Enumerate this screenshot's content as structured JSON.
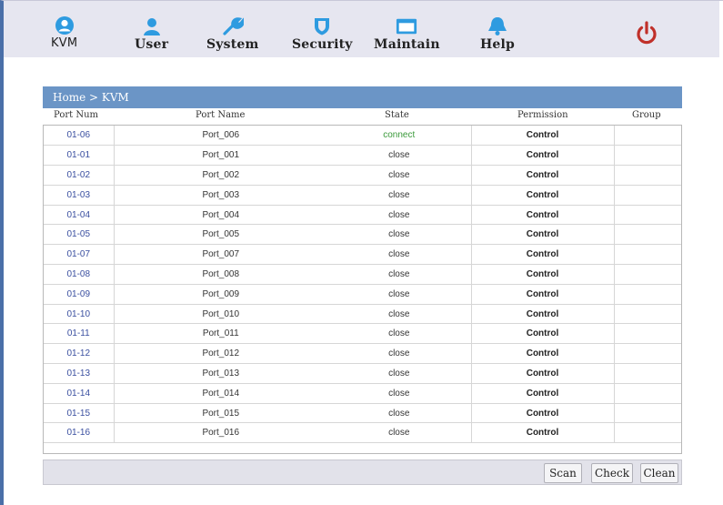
{
  "nav": {
    "items": [
      {
        "label": "KVM",
        "icon": "user-circle-icon"
      },
      {
        "label": "User",
        "icon": "user-icon"
      },
      {
        "label": "System",
        "icon": "wrench-icon"
      },
      {
        "label": "Security",
        "icon": "shield-icon"
      },
      {
        "label": "Maintain",
        "icon": "monitor-icon"
      },
      {
        "label": "Help",
        "icon": "bell-icon"
      }
    ],
    "power_icon": "power-icon",
    "accent": "#2e9be0",
    "power_color": "#c0302a"
  },
  "breadcrumb": "Home > KVM",
  "columns": {
    "num": "Port Num",
    "name": "Port Name",
    "state": "State",
    "perm": "Permission",
    "group": "Group"
  },
  "rows": [
    {
      "num": "01-06",
      "name": "Port_006",
      "state": "connect",
      "perm": "Control",
      "group": ""
    },
    {
      "num": "01-01",
      "name": "Port_001",
      "state": "close",
      "perm": "Control",
      "group": ""
    },
    {
      "num": "01-02",
      "name": "Port_002",
      "state": "close",
      "perm": "Control",
      "group": ""
    },
    {
      "num": "01-03",
      "name": "Port_003",
      "state": "close",
      "perm": "Control",
      "group": ""
    },
    {
      "num": "01-04",
      "name": "Port_004",
      "state": "close",
      "perm": "Control",
      "group": ""
    },
    {
      "num": "01-05",
      "name": "Port_005",
      "state": "close",
      "perm": "Control",
      "group": ""
    },
    {
      "num": "01-07",
      "name": "Port_007",
      "state": "close",
      "perm": "Control",
      "group": ""
    },
    {
      "num": "01-08",
      "name": "Port_008",
      "state": "close",
      "perm": "Control",
      "group": ""
    },
    {
      "num": "01-09",
      "name": "Port_009",
      "state": "close",
      "perm": "Control",
      "group": ""
    },
    {
      "num": "01-10",
      "name": "Port_010",
      "state": "close",
      "perm": "Control",
      "group": ""
    },
    {
      "num": "01-11",
      "name": "Port_011",
      "state": "close",
      "perm": "Control",
      "group": ""
    },
    {
      "num": "01-12",
      "name": "Port_012",
      "state": "close",
      "perm": "Control",
      "group": ""
    },
    {
      "num": "01-13",
      "name": "Port_013",
      "state": "close",
      "perm": "Control",
      "group": ""
    },
    {
      "num": "01-14",
      "name": "Port_014",
      "state": "close",
      "perm": "Control",
      "group": ""
    },
    {
      "num": "01-15",
      "name": "Port_015",
      "state": "close",
      "perm": "Control",
      "group": ""
    },
    {
      "num": "01-16",
      "name": "Port_016",
      "state": "close",
      "perm": "Control",
      "group": ""
    }
  ],
  "buttons": {
    "scan": "Scan",
    "check": "Check",
    "clean": "Clean"
  }
}
